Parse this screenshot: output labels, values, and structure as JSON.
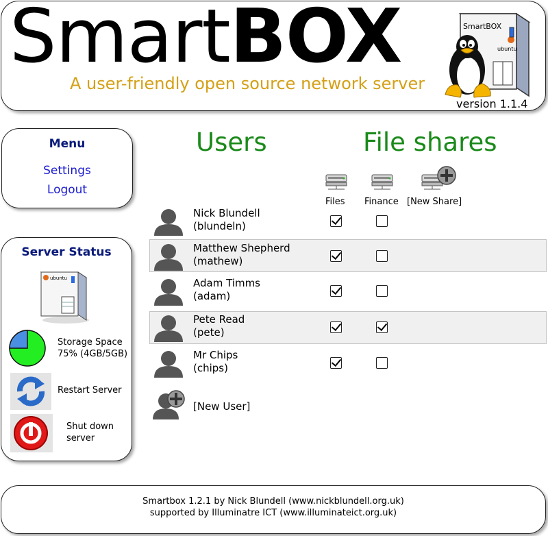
{
  "header": {
    "title_regular": "Smart",
    "title_bold": "BOX",
    "tagline": "A user-friendly open source network server",
    "version": "version 1.1.4",
    "logo_box_label": "SmartBOX",
    "logo_brand": "ubuntu"
  },
  "menu": {
    "title": "Menu",
    "items": [
      {
        "label": "Settings"
      },
      {
        "label": "Logout"
      }
    ]
  },
  "status": {
    "title": "Server Status",
    "server_brand": "ubuntu",
    "storage": {
      "label": "Storage Space",
      "detail": "75% (4GB/5GB)",
      "used_fraction": 0.75
    },
    "restart_label": "Restart Server",
    "shutdown_line1": "Shut down",
    "shutdown_line2": "server"
  },
  "main": {
    "users_heading": "Users",
    "shares_heading": "File shares",
    "shares": [
      {
        "label": "Files"
      },
      {
        "label": "Finance"
      },
      {
        "label": "[New Share]"
      }
    ],
    "users": [
      {
        "name": "Nick Blundell",
        "username": "(blundeln)",
        "files": true,
        "finance": false,
        "highlighted": false
      },
      {
        "name": "Matthew Shepherd",
        "username": "(mathew)",
        "files": true,
        "finance": false,
        "highlighted": true
      },
      {
        "name": "Adam Timms",
        "username": "(adam)",
        "files": true,
        "finance": false,
        "highlighted": false
      },
      {
        "name": "Pete Read",
        "username": "(pete)",
        "files": true,
        "finance": true,
        "highlighted": true
      },
      {
        "name": "Mr Chips",
        "username": "(chips)",
        "files": true,
        "finance": false,
        "highlighted": false
      }
    ],
    "new_user_label": "[New User]"
  },
  "footer": {
    "line1": "Smartbox 1.2.1 by Nick Blundell (www.nickblundell.org.uk)",
    "line2": "supported by Illuminatre ICT (www.illuminateict.org.uk)"
  },
  "colors": {
    "heading_green": "#1a8a1a",
    "tagline_gold": "#d4a017",
    "panel_title_navy": "#0a1a7a",
    "link_blue": "#1a1ad0",
    "pie_used": "#22ee22",
    "pie_free": "#4a90e2"
  }
}
